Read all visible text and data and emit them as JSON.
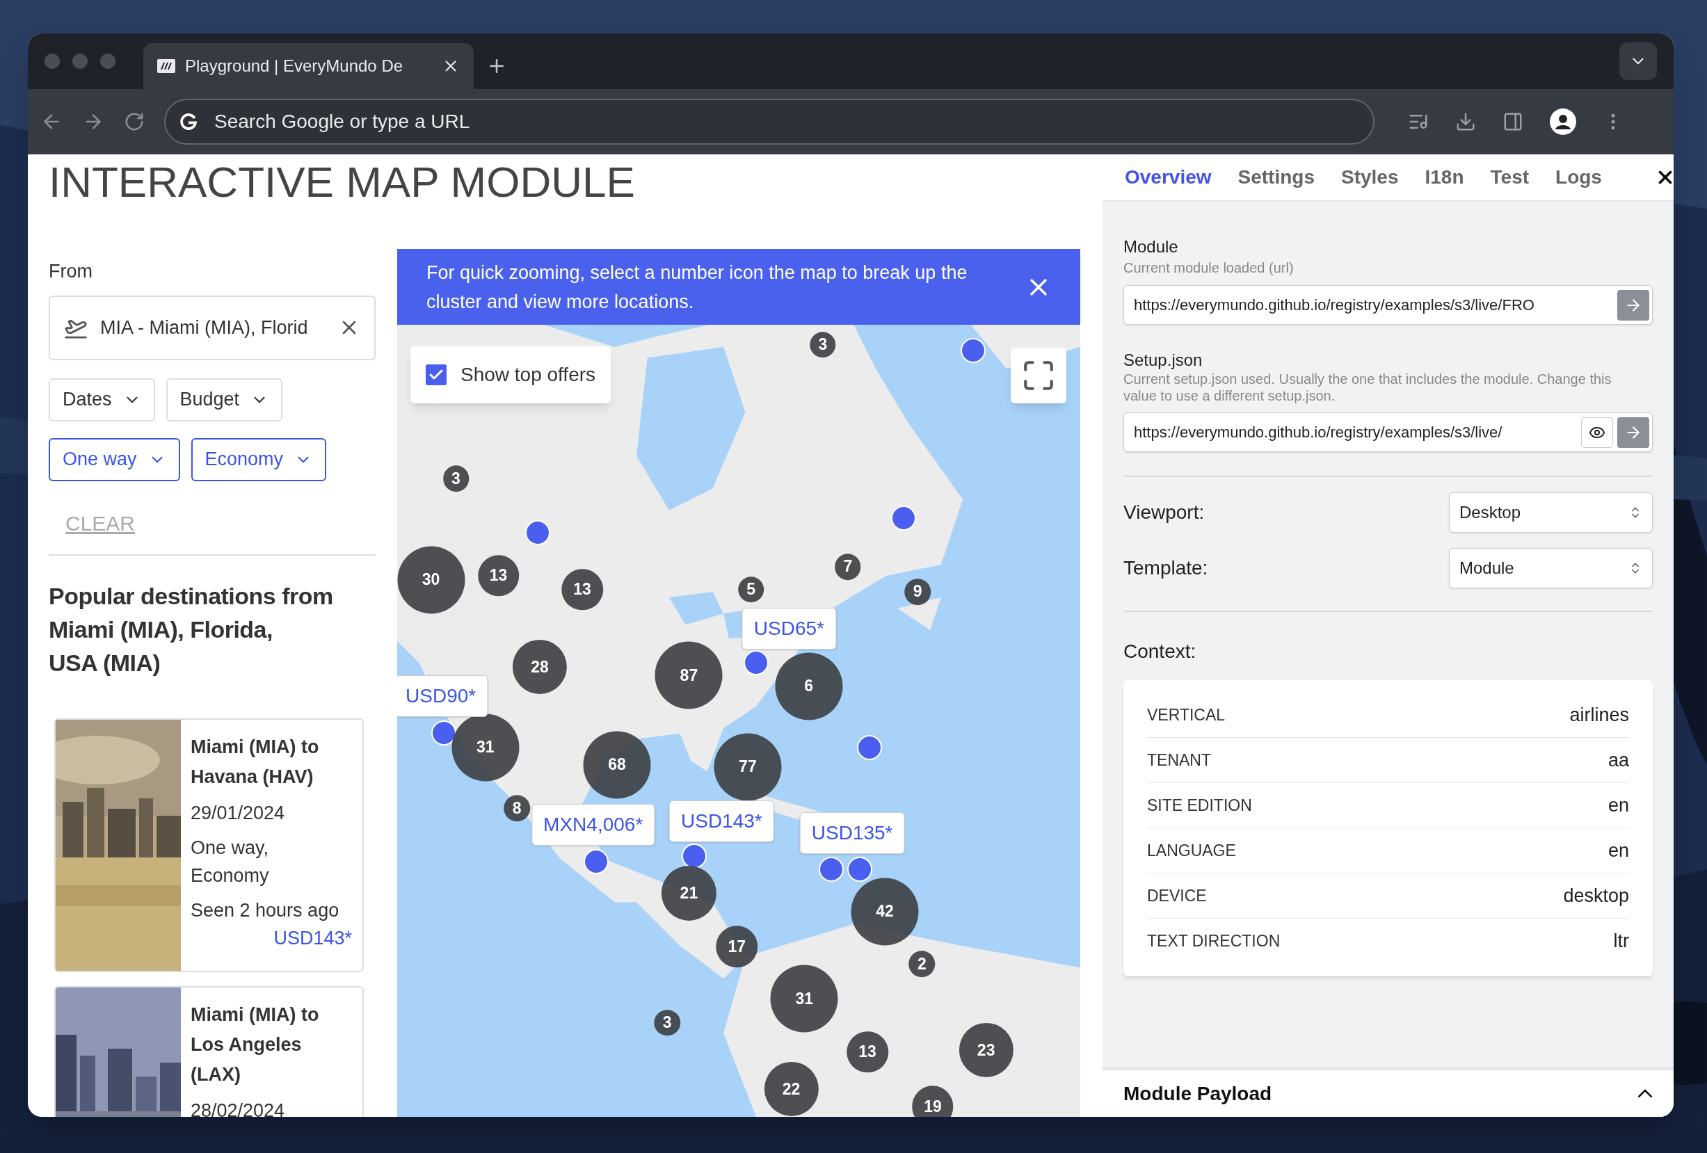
{
  "browser": {
    "tab_title": "Playground | EveryMundo De",
    "address_placeholder": "Search Google or type a URL"
  },
  "page": {
    "title": "INTERACTIVE MAP MODULE"
  },
  "search": {
    "label": "From",
    "value": "MIA - Miami (MIA), Florid"
  },
  "filters": [
    {
      "label": "Dates",
      "active": false
    },
    {
      "label": "Budget",
      "active": false
    },
    {
      "label": "One way",
      "active": true
    },
    {
      "label": "Economy",
      "active": true
    }
  ],
  "clear_button": "CLEAR",
  "popular_heading": [
    "Popular destinations from",
    "Miami (MIA), Florida,",
    "USA (MIA)"
  ],
  "destinations": [
    {
      "route": "Miami (MIA) to Havana (HAV)",
      "date": "29/01/2024",
      "trip": "One way,",
      "cabin": "Economy",
      "seen": "Seen 2 hours ago",
      "price": "USD143*"
    },
    {
      "route": "Miami (MIA) to Los Angeles (LAX)",
      "date": "28/02/2024"
    }
  ],
  "map": {
    "banner": "For quick zooming, select a number icon the map to break up the cluster and view more locations.",
    "show_top_offers": {
      "label": "Show top offers",
      "checked": true
    },
    "clusters": [
      {
        "count": "3"
      },
      {
        "count": "3"
      },
      {
        "count": "30"
      },
      {
        "count": "13"
      },
      {
        "count": "13"
      },
      {
        "count": "5"
      },
      {
        "count": "7"
      },
      {
        "count": "9"
      },
      {
        "count": "28"
      },
      {
        "count": "87"
      },
      {
        "count": "6"
      },
      {
        "count": "31"
      },
      {
        "count": "68"
      },
      {
        "count": "77"
      },
      {
        "count": "8"
      },
      {
        "count": "21"
      },
      {
        "count": "17"
      },
      {
        "count": "42"
      },
      {
        "count": "2"
      },
      {
        "count": "31"
      },
      {
        "count": "3"
      },
      {
        "count": "13"
      },
      {
        "count": "23"
      },
      {
        "count": "22"
      },
      {
        "count": "19"
      }
    ],
    "price_tags": [
      {
        "price": "USD65*"
      },
      {
        "price": "USD90*"
      },
      {
        "price": "USD143*"
      },
      {
        "price": "MXN4,006*"
      },
      {
        "price": "USD135*"
      }
    ]
  },
  "panel": {
    "tabs": [
      {
        "label": "Overview",
        "selected": true
      },
      {
        "label": "Settings",
        "selected": false
      },
      {
        "label": "Styles",
        "selected": false
      },
      {
        "label": "I18n",
        "selected": false
      },
      {
        "label": "Test",
        "selected": false
      },
      {
        "label": "Logs",
        "selected": false
      }
    ],
    "module": {
      "label": "Module",
      "hint": "Current module loaded (url)",
      "value": "https://everymundo.github.io/registry/examples/s3/live/FRO"
    },
    "setup": {
      "label": "Setup.json",
      "hint": "Current setup.json used. Usually the one that includes the module. Change this value to use a different setup.json.",
      "value": "https://everymundo.github.io/registry/examples/s3/live/"
    },
    "viewport": {
      "label": "Viewport:",
      "value": "Desktop"
    },
    "template": {
      "label": "Template:",
      "value": "Module"
    },
    "context": {
      "label": "Context:",
      "rows": [
        {
          "key": "VERTICAL",
          "value": "airlines"
        },
        {
          "key": "TENANT",
          "value": "aa"
        },
        {
          "key": "SITE EDITION",
          "value": "en"
        },
        {
          "key": "LANGUAGE",
          "value": "en"
        },
        {
          "key": "DEVICE",
          "value": "desktop"
        },
        {
          "key": "TEXT DIRECTION",
          "value": "ltr"
        }
      ]
    },
    "payload": {
      "title": "Module Payload",
      "expanded": true
    }
  }
}
